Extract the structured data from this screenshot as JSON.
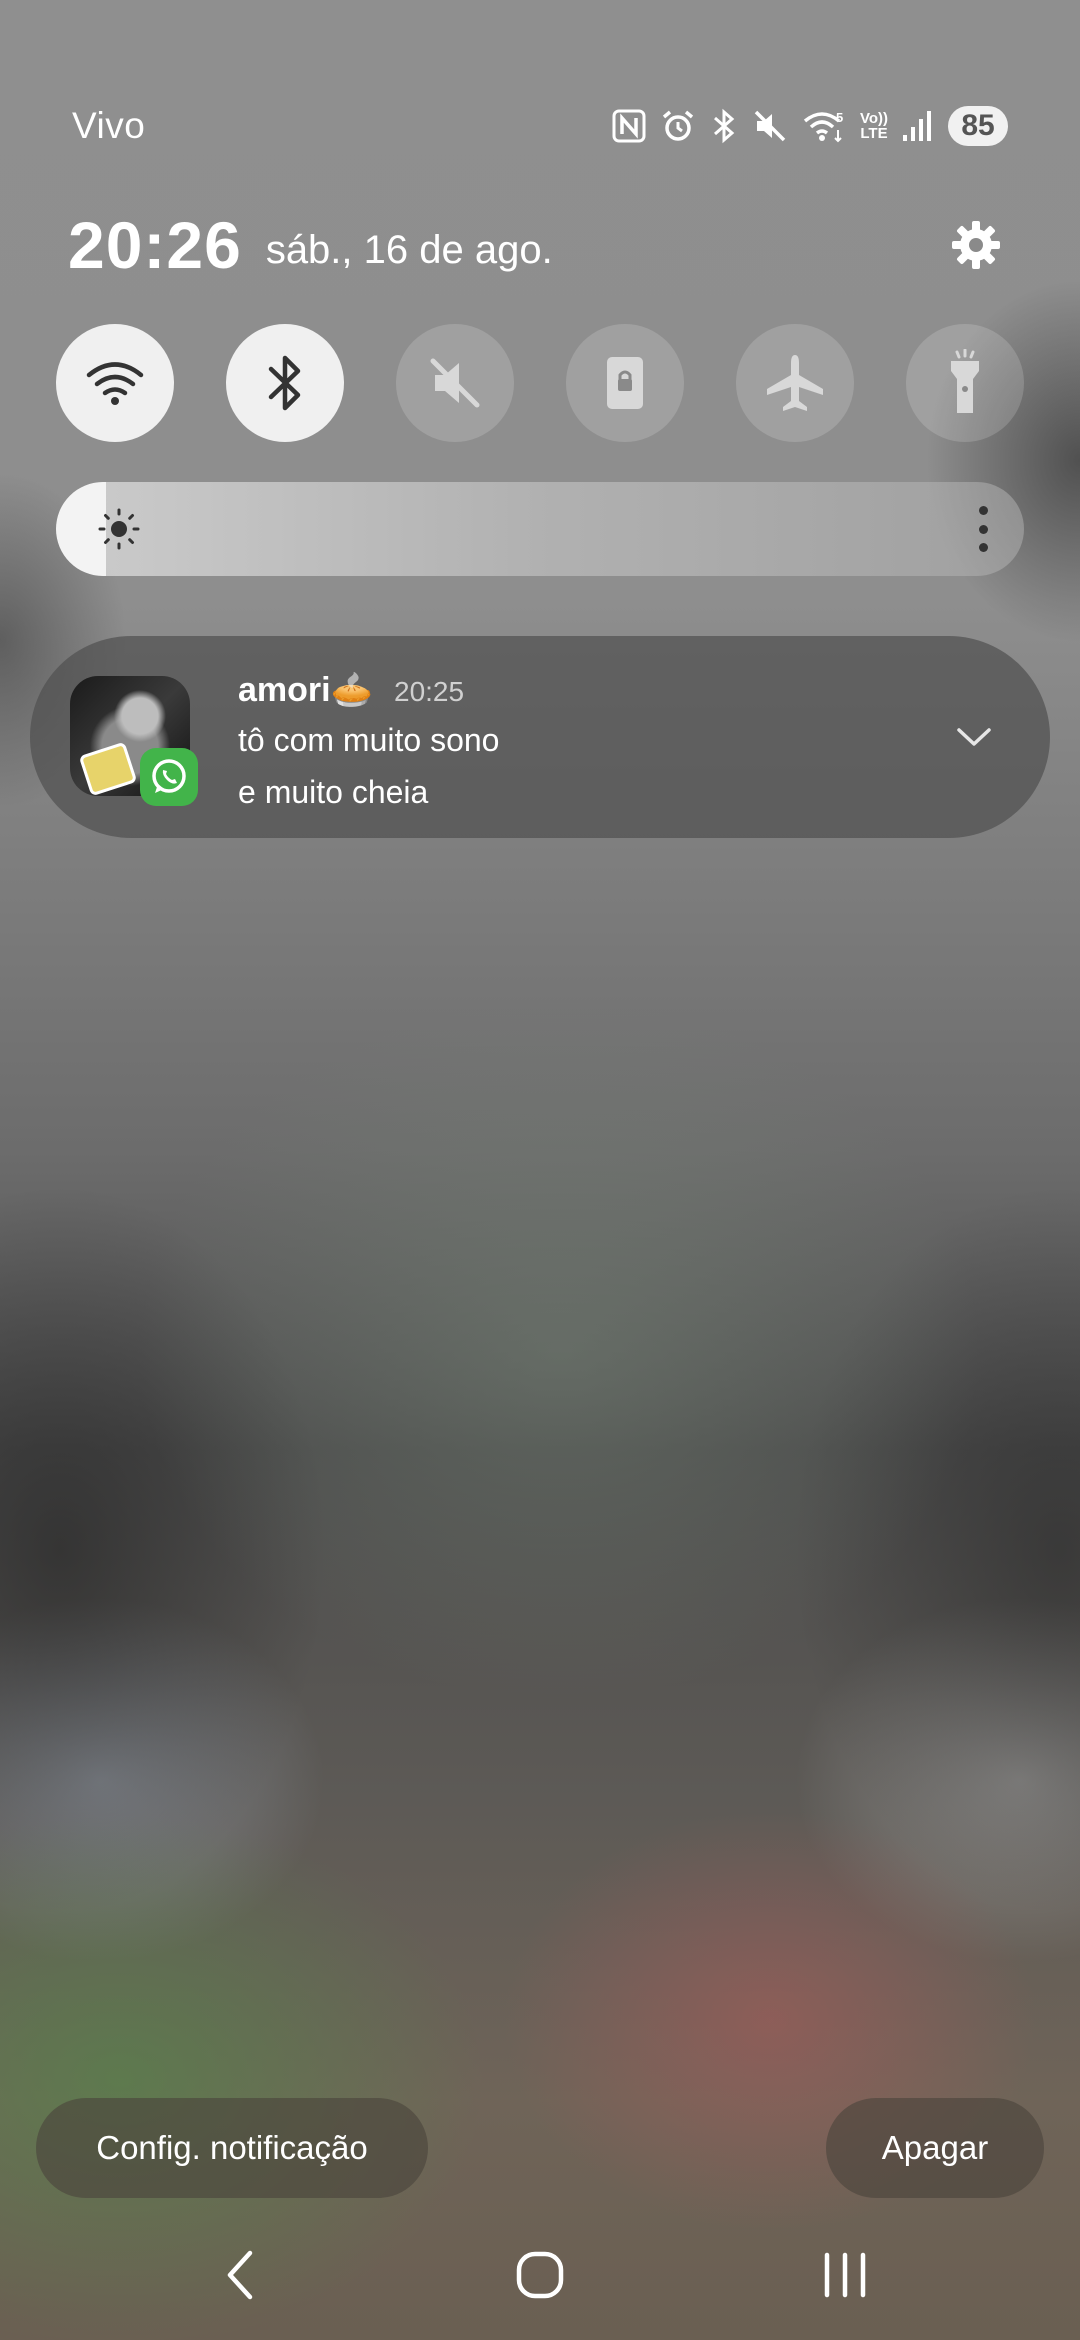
{
  "status_bar": {
    "carrier": "Vivo",
    "network_badge": "5",
    "volte_top": "Vo))",
    "volte_bottom": "LTE",
    "battery": "85",
    "icons": [
      "nfc-icon",
      "alarm-icon",
      "bluetooth-icon",
      "mute-icon",
      "wifi-icon",
      "volte-icon",
      "signal-icon",
      "battery-icon"
    ]
  },
  "header": {
    "time": "20:26",
    "date": "sáb., 16 de ago."
  },
  "quick_toggles": [
    {
      "name": "wifi",
      "icon": "wifi-icon",
      "state": "on"
    },
    {
      "name": "bluetooth",
      "icon": "bluetooth-icon",
      "state": "on"
    },
    {
      "name": "sound",
      "icon": "mute-icon",
      "state": "off"
    },
    {
      "name": "rotation-lock",
      "icon": "lock-icon",
      "state": "off"
    },
    {
      "name": "airplane",
      "icon": "airplane-icon",
      "state": "off"
    },
    {
      "name": "flashlight",
      "icon": "flashlight-icon",
      "state": "off"
    }
  ],
  "brightness": {
    "level": 0.05
  },
  "notification": {
    "sender": "amori🥧",
    "time": "20:25",
    "line1": "tô com muito sono",
    "line2": "e muito cheia",
    "app_icon": "whatsapp-icon"
  },
  "actions": {
    "settings_label": "Config. notificação",
    "clear_label": "Apagar"
  },
  "colors": {
    "toggle_on": "#f0f0f0",
    "whatsapp_green": "#42b44a"
  }
}
